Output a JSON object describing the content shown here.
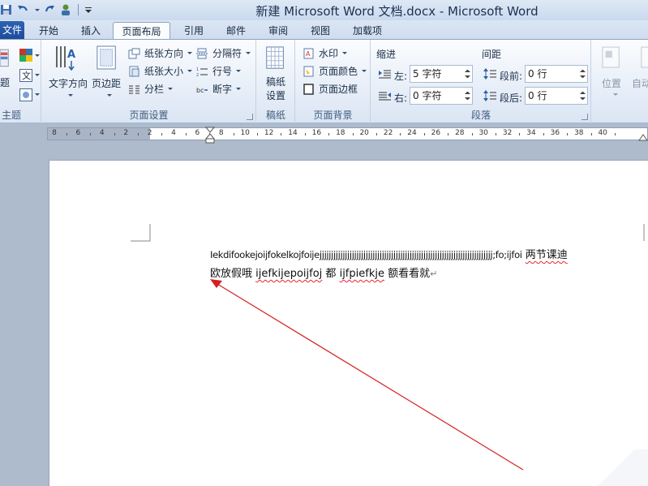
{
  "window": {
    "title": "新建 Microsoft Word 文档.docx - Microsoft Word"
  },
  "tabs": [
    {
      "label": "文件"
    },
    {
      "label": "开始"
    },
    {
      "label": "插入"
    },
    {
      "label": "页面布局"
    },
    {
      "label": "引用"
    },
    {
      "label": "邮件"
    },
    {
      "label": "审阅"
    },
    {
      "label": "视图"
    },
    {
      "label": "加载项"
    }
  ],
  "ribbon": {
    "theme": {
      "label": "主题",
      "btn1": "题"
    },
    "page_setup": {
      "label": "页面设置",
      "text_direction": "文字方向",
      "margins": "页边距",
      "orientation": "纸张方向",
      "size": "纸张大小",
      "columns": "分栏",
      "breaks": "分隔符",
      "line_numbers": "行号",
      "hyphenation": "断字"
    },
    "draft": {
      "label": "稿纸",
      "draft_settings": "稿纸\n设置"
    },
    "page_background": {
      "label": "页面背景",
      "watermark": "水印",
      "page_color": "页面颜色",
      "page_borders": "页面边框"
    },
    "paragraph": {
      "label": "段落",
      "indent_title": "缩进",
      "spacing_title": "间距",
      "indent_left_label": "左:",
      "indent_left_value": "5 字符",
      "indent_right_label": "右:",
      "indent_right_value": "0 字符",
      "space_before_label": "段前:",
      "space_before_value": "0 行",
      "space_after_label": "段后:",
      "space_after_value": "0 行"
    },
    "arrange": {
      "position": "位置",
      "wrap": "自动"
    }
  },
  "ruler": {
    "labels": [
      "8",
      "6",
      "4",
      "2",
      "2",
      "4",
      "6",
      "8",
      "10",
      "12",
      "14",
      "16",
      "18",
      "20",
      "22",
      "24",
      "26",
      "28",
      "30",
      "32",
      "34",
      "36",
      "38",
      "40"
    ]
  },
  "document": {
    "line1_a": "Iekdifookejoijfokelkojfoijejjjjjjjjjjjjjjjjjjjjjjjjjjjjjjjjjjjjjjjjjjjjjjjjjjjjjjjjjjjjjjjjjjjjjjjjjjj;fo;ijfoi",
    "line1_b": "两节课迪",
    "line2_a": "欧放假哦",
    "line2_b": "ijefkijepoijfoj",
    "line2_c": "都",
    "line2_d": "ijfpiefkje",
    "line2_e": "额看看就",
    "para_mark": "↵"
  },
  "colors": {
    "arrow": "#d42020",
    "file_tab": "#2a5caa"
  }
}
